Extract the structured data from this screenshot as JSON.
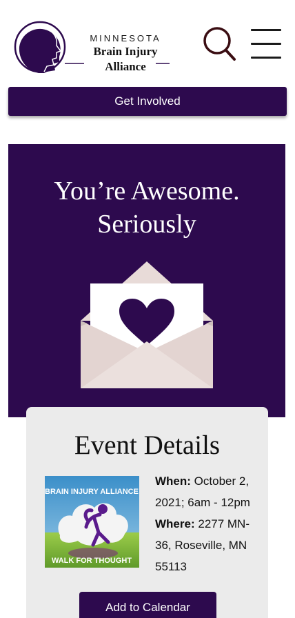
{
  "header": {
    "logo_line1": "MINNESOTA",
    "logo_line2": "Brain Injury",
    "logo_line3": "Alliance"
  },
  "nav": {
    "get_involved_label": "Get Involved"
  },
  "hero": {
    "title_line1": "You’re Awesome.",
    "title_line2": "Seriously"
  },
  "event": {
    "title": "Event Details",
    "when_label": "When:",
    "when_value": "October 2, 2021; 6am - 12pm",
    "where_label": "Where:",
    "where_value": "2277 MN-36, Roseville, MN 55113",
    "logo_text_top": "BRAIN INJURY ALLIANCE",
    "logo_text_bottom": "WALK FOR THOUGHT",
    "add_calendar_label": "Add to Calendar"
  },
  "colors": {
    "brand_purple": "#2d0a4e",
    "card_gray": "#ebebeb",
    "envelope_pink": "#eaddda"
  },
  "icons": [
    "head-profile-icon",
    "search-icon",
    "hamburger-menu-icon",
    "envelope-heart-icon"
  ]
}
